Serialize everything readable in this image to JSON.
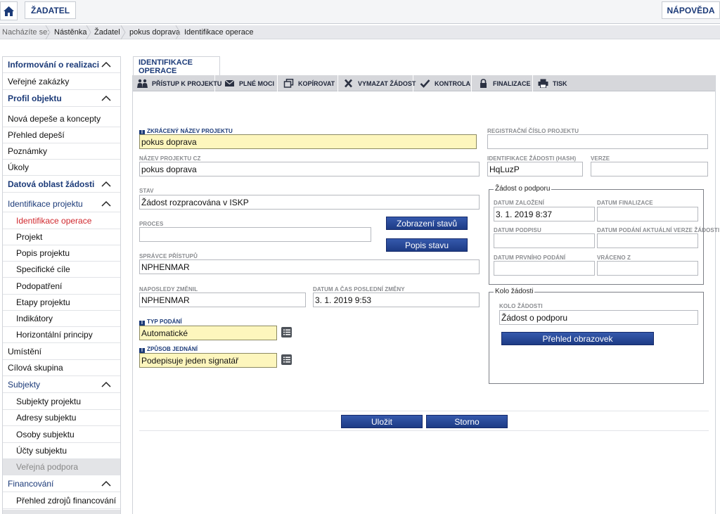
{
  "topbar": {
    "zadatel_label": "ŽADATEL",
    "napoveda_label": "NÁPOVĚDA"
  },
  "breadcrumb": {
    "label": "Nacházíte se:",
    "items": [
      "Nástěnka",
      "Žadatel",
      "pokus doprava",
      "Identifikace operace"
    ]
  },
  "sidebar": {
    "items": [
      {
        "label": "Informování o realizaci"
      },
      {
        "label": "Veřejné zakázky"
      },
      {
        "label": "Profil objektu"
      },
      {
        "label": "Nová depeše a koncepty"
      },
      {
        "label": "Přehled depeší"
      },
      {
        "label": "Poznámky"
      },
      {
        "label": "Úkoly"
      },
      {
        "label": "Datová oblast žádosti"
      },
      {
        "label": "Identifikace projektu"
      },
      {
        "label": "Identifikace operace"
      },
      {
        "label": "Projekt"
      },
      {
        "label": "Popis projektu"
      },
      {
        "label": "Specifické cíle"
      },
      {
        "label": "Podopatření"
      },
      {
        "label": "Etapy projektu"
      },
      {
        "label": "Indikátory"
      },
      {
        "label": "Horizontální principy"
      },
      {
        "label": "Umístění"
      },
      {
        "label": "Cílová skupina"
      },
      {
        "label": "Subjekty"
      },
      {
        "label": "Subjekty projektu"
      },
      {
        "label": "Adresy subjektu"
      },
      {
        "label": "Osoby subjektu"
      },
      {
        "label": "Účty subjektu"
      },
      {
        "label": "Veřejná podpora"
      },
      {
        "label": "Financování"
      },
      {
        "label": "Přehled zdrojů financování"
      }
    ]
  },
  "main": {
    "tab_label": "IDENTIFIKACE OPERACE",
    "toolbar": {
      "pristup": "PŘÍSTUP K PROJEKTU",
      "plne_moci": "PLNÉ MOCI",
      "kopirovat": "KOPÍROVAT",
      "vymazat": "VYMAZAT ŽÁDOST",
      "kontrola": "KONTROLA",
      "finalizace": "FINALIZACE",
      "tisk": "TISK"
    },
    "form": {
      "zkraceny_nazev": {
        "label": "ZKRÁCENÝ NÁZEV PROJEKTU",
        "value": "pokus doprava"
      },
      "nazev_cz": {
        "label": "NÁZEV PROJEKTU CZ",
        "value": "pokus doprava"
      },
      "stav": {
        "label": "STAV",
        "value": "Žádost rozpracována v ISKP"
      },
      "proces": {
        "label": "PROCES",
        "value": ""
      },
      "zobrazeni_stavu": "Zobrazení stavů",
      "popis_stavu": "Popis stavu",
      "spravce": {
        "label": "SPRÁVCE PŘÍSTUPŮ",
        "value": "NPHENMAR"
      },
      "naposledy": {
        "label": "NAPOSLEDY ZMĚNIL",
        "value": "NPHENMAR"
      },
      "datum_zmeny": {
        "label": "DATUM A ČAS POSLEDNÍ ZMĚNY",
        "value": "3. 1. 2019 9:53"
      },
      "typ_podani": {
        "label": "TYP PODÁNÍ",
        "value": "Automatické"
      },
      "zpusob_jednani": {
        "label": "ZPŮSOB JEDNÁNÍ",
        "value": "Podepisuje jeden signatář"
      },
      "registracni_cislo": {
        "label": "REGISTRAČNÍ ČÍSLO PROJEKTU",
        "value": ""
      },
      "hash": {
        "label": "IDENTIFIKACE ŽÁDOSTI (HASH)",
        "value": "HqLuzP"
      },
      "verze": {
        "label": "VERZE",
        "value": ""
      }
    },
    "zadost": {
      "legend": "Žádost o podporu",
      "datum_zalozeni": {
        "label": "DATUM ZALOŽENÍ",
        "value": "3. 1. 2019 8:37"
      },
      "datum_finalizace": {
        "label": "DATUM FINALIZACE",
        "value": ""
      },
      "datum_podpisu": {
        "label": "DATUM PODPISU",
        "value": ""
      },
      "datum_podani_verze": {
        "label": "DATUM PODÁNÍ AKTUÁLNÍ VERZE ŽÁDOSTI",
        "value": ""
      },
      "datum_prvniho": {
        "label": "DATUM PRVNÍHO PODÁNÍ",
        "value": ""
      },
      "vraceno_z": {
        "label": "VRÁCENO Z",
        "value": ""
      }
    },
    "kolo": {
      "legend": "Kolo žádosti",
      "kolo_zadosti": {
        "label": "KOLO ŽÁDOSTI",
        "value": "Žádost o podporu"
      },
      "prehled_button": "Přehled obrazovek"
    },
    "actions": {
      "ulozit": "Uložit",
      "storno": "Storno"
    }
  }
}
